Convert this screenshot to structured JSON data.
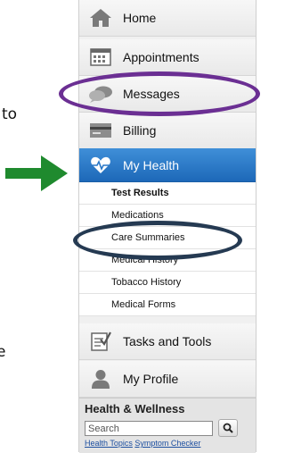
{
  "fragments": {
    "top": "to",
    "bottom": "e"
  },
  "nav": {
    "home": "Home",
    "appointments": "Appointments",
    "messages": "Messages",
    "billing": "Billing",
    "my_health": "My Health",
    "tasks": "Tasks and Tools",
    "profile": "My Profile"
  },
  "sub_items": [
    "Test Results",
    "Medications",
    "Care Summaries",
    "Medical History",
    "Tobacco History",
    "Medical Forms"
  ],
  "health_wellness": {
    "title": "Health & Wellness",
    "search_placeholder": "Search",
    "link_topics": "Health Topics",
    "link_checker": "Symptom Checker"
  },
  "colors": {
    "active_blue": "#2a78c8",
    "arrow_green": "#1f8a2e",
    "highlight_purple": "#6b2f93",
    "highlight_navy": "#253a52"
  }
}
